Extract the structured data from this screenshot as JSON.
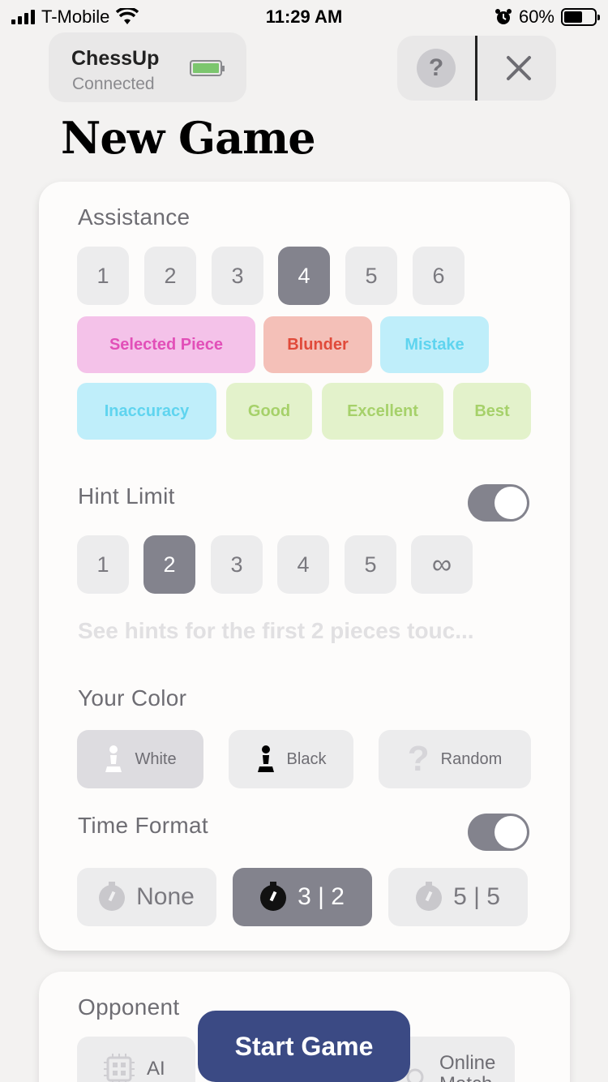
{
  "status_bar": {
    "carrier": "T-Mobile",
    "time": "11:29 AM",
    "battery": "60%"
  },
  "device": {
    "name": "ChessUp",
    "status": "Connected"
  },
  "header": {
    "title": "New Game",
    "help_glyph": "?",
    "close_glyph": "✕"
  },
  "assistance": {
    "label": "Assistance",
    "levels": [
      "1",
      "2",
      "3",
      "4",
      "5",
      "6"
    ],
    "selected": "4",
    "tags": [
      {
        "label": "Selected Piece",
        "bg": "#f4c2e9",
        "color": "#e24fb8"
      },
      {
        "label": "Blunder",
        "bg": "#f4c0b8",
        "color": "#e04a3a"
      },
      {
        "label": "Mistake",
        "bg": "#bfeefa",
        "color": "#5fd4ef"
      },
      {
        "label": "Inaccuracy",
        "bg": "#bfeefa",
        "color": "#5fd4ef"
      },
      {
        "label": "Good",
        "bg": "#e3f2cb",
        "color": "#a6d16a"
      },
      {
        "label": "Excellent",
        "bg": "#e3f2cb",
        "color": "#a6d16a"
      },
      {
        "label": "Best",
        "bg": "#e3f2cb",
        "color": "#a6d16a"
      }
    ]
  },
  "hint_limit": {
    "label": "Hint Limit",
    "enabled": true,
    "options": [
      "1",
      "2",
      "3",
      "4",
      "5",
      "∞"
    ],
    "selected": "2",
    "description": "See hints for the first 2 pieces touc..."
  },
  "your_color": {
    "label": "Your Color",
    "options": [
      {
        "label": "White",
        "icon": "white-pawn-icon"
      },
      {
        "label": "Black",
        "icon": "black-pawn-icon"
      },
      {
        "label": "Random",
        "icon": "question-icon"
      }
    ],
    "selected": "White"
  },
  "time_format": {
    "label": "Time Format",
    "enabled": true,
    "options": [
      "None",
      "3 | 2",
      "5 | 5"
    ],
    "selected": "3 | 2"
  },
  "opponent": {
    "label": "Opponent",
    "options": [
      {
        "label": "AI",
        "icon": "chip-icon"
      },
      {
        "label": "Online Match",
        "icon": "globe-icon"
      }
    ]
  },
  "start_button": "Start Game",
  "colors": {
    "accent": "#3b4a84",
    "selected": "#83838d"
  }
}
